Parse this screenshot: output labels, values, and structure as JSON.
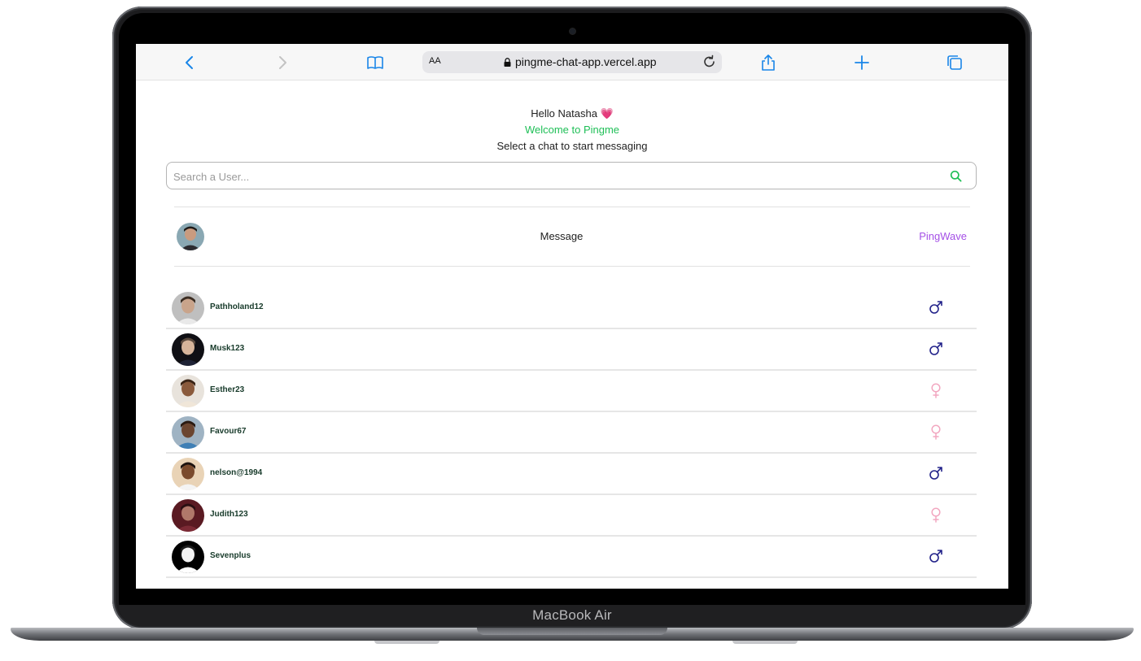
{
  "device": {
    "label": "MacBook Air"
  },
  "browser": {
    "text_size_label": "AA",
    "url": "pingme-chat-app.vercel.app",
    "icons": [
      "chevron-left-icon",
      "chevron-right-icon",
      "book-icon",
      "lock-icon",
      "reload-icon",
      "share-icon",
      "plus-icon",
      "tabs-icon"
    ]
  },
  "page": {
    "hello": "Hello Natasha 💗",
    "welcome": "Welcome to Pingme",
    "subtitle": "Select a chat to start messaging",
    "welcome_color": "#1fbf57"
  },
  "search": {
    "placeholder": "Search a User...",
    "icon": "search-icon"
  },
  "header_row": {
    "message_label": "Message",
    "brand_link": "PingWave",
    "brand_color": "#a44fe6"
  },
  "users": [
    {
      "name": "Pathholand12",
      "gender": "male"
    },
    {
      "name": "Musk123",
      "gender": "male"
    },
    {
      "name": "Esther23",
      "gender": "female"
    },
    {
      "name": "Favour67",
      "gender": "female"
    },
    {
      "name": "nelson@1994",
      "gender": "male"
    },
    {
      "name": "Judith123",
      "gender": "female"
    },
    {
      "name": "Sevenplus",
      "gender": "male"
    }
  ],
  "colors": {
    "male": "#23238a",
    "female": "#f2a7c0"
  }
}
